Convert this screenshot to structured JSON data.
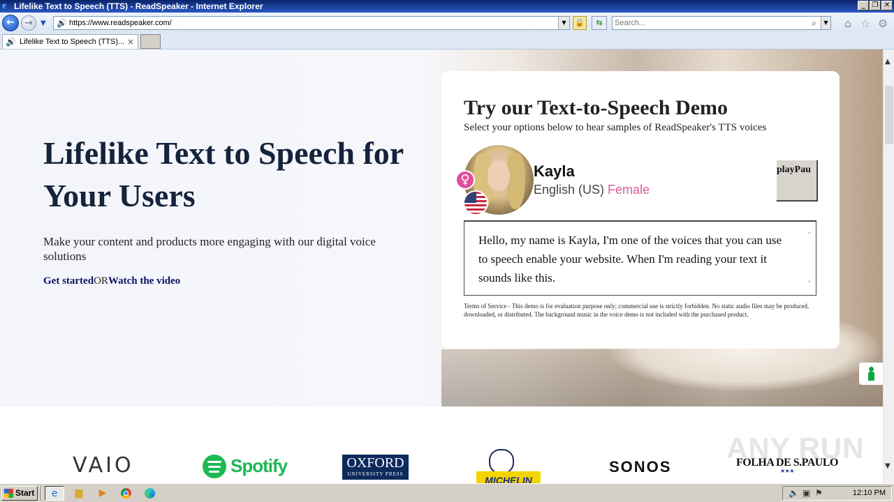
{
  "window": {
    "title": "Lifelike Text to Speech (TTS) - ReadSpeaker - Internet Explorer",
    "controls": {
      "minimize": "_",
      "maximize": "❐",
      "close": "✕"
    }
  },
  "browser": {
    "url": "https://www.readspeaker.com/",
    "search_placeholder": "Search...",
    "tab": {
      "label": "Lifelike Text to Speech (TTS)...",
      "close": "×"
    },
    "icons": [
      "back-icon",
      "forward-icon",
      "speaker-icon",
      "lock-icon",
      "refresh-icon",
      "search-icon",
      "home-icon",
      "favorites-star-icon",
      "settings-gear-icon"
    ]
  },
  "hero": {
    "title": "Lifelike Text to Speech for Your Users",
    "subtitle": "Make your content and products more engaging with our digital voice solutions",
    "cta_primary": "Get started",
    "cta_separator": "OR",
    "cta_secondary": "Watch the video"
  },
  "demo": {
    "title": "Try our Text-to-Speech Demo",
    "subtitle": "Select your options below to hear samples of ReadSpeaker's TTS voices",
    "voice": {
      "name": "Kayla",
      "language": "English (US)",
      "gender": "Female"
    },
    "play_button": "playPau",
    "text": "Hello, my name is Kayla, I'm one of the voices that you can use to speech enable your website. When I'm reading your text it sounds like this.",
    "terms": "Terms of Service - This demo is for evaluation purpose only; commercial use is strictly forbidden. No static audio files may be produced, downloaded, or distributed. The background music in the voice demo is not included with the purchased product."
  },
  "logos": {
    "vaio": "VAIO",
    "spotify": "Spotify",
    "oxford_line1": "OXFORD",
    "oxford_line2": "UNIVERSITY PRESS",
    "michelin": "MICHELIN",
    "sonos": "SONOS",
    "folha": "FOLHA DE S.PAULO",
    "folha_stars": "★★★"
  },
  "watermark": "ANY RUN",
  "taskbar": {
    "start": "Start",
    "clock": "12:10 PM"
  },
  "colors": {
    "hero_title": "#15233b",
    "link": "#0b1260",
    "gender_accent": "#d95c9e",
    "spotify_green": "#1db954",
    "feedback_green": "#0aa83f"
  }
}
